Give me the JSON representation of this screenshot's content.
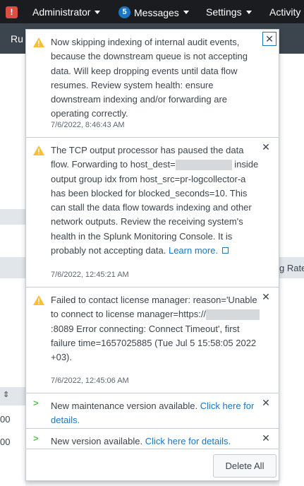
{
  "topbar": {
    "admin_label": "Administrator",
    "messages_count": "5",
    "messages_label": "Messages",
    "settings_label": "Settings",
    "activity_label": "Activity"
  },
  "subbar": {
    "text": "Ru"
  },
  "background": {
    "col_header": "g Rate",
    "cell_a": "00",
    "cell_b": "00"
  },
  "messages": [
    {
      "text": "Now skipping indexing of internal audit events, because the downstream queue is not accepting data. Will keep dropping events until data flow resumes. Review system health: ensure downstream indexing and/or forwarding are operating correctly.",
      "time": "7/6/2022, 8:46:43 AM"
    },
    {
      "text_a": "The TCP output processor has paused the data flow. Forwarding to host_dest=",
      "text_b": " inside output group idx from host_src=pr-logcollector-a has been blocked for blocked_seconds=10. This can stall the data flow towards indexing and other network outputs. Review the receiving system's health in the Splunk Monitoring Console. It is probably not accepting data.",
      "link": "Learn more.",
      "time": "7/6/2022, 12:45:21 AM"
    },
    {
      "text_a": "Failed to contact license manager: reason='Unable to connect to license manager=https://",
      "text_b": ":8089 Error connecting: Connect Timeout', first failure time=1657025885 (Tue Jul 5 15:58:05 2022 +03).",
      "time": "7/6/2022, 12:45:06 AM"
    },
    {
      "text": "New maintenance version available.",
      "link": "Click here for details."
    },
    {
      "text": "New version available.",
      "link": "Click here for details."
    }
  ],
  "delete_all_label": "Delete All",
  "colors": {
    "accent": "#1a75c5",
    "warning": "#f8be34",
    "success": "#5cc05c",
    "alert": "#dc4e41"
  }
}
